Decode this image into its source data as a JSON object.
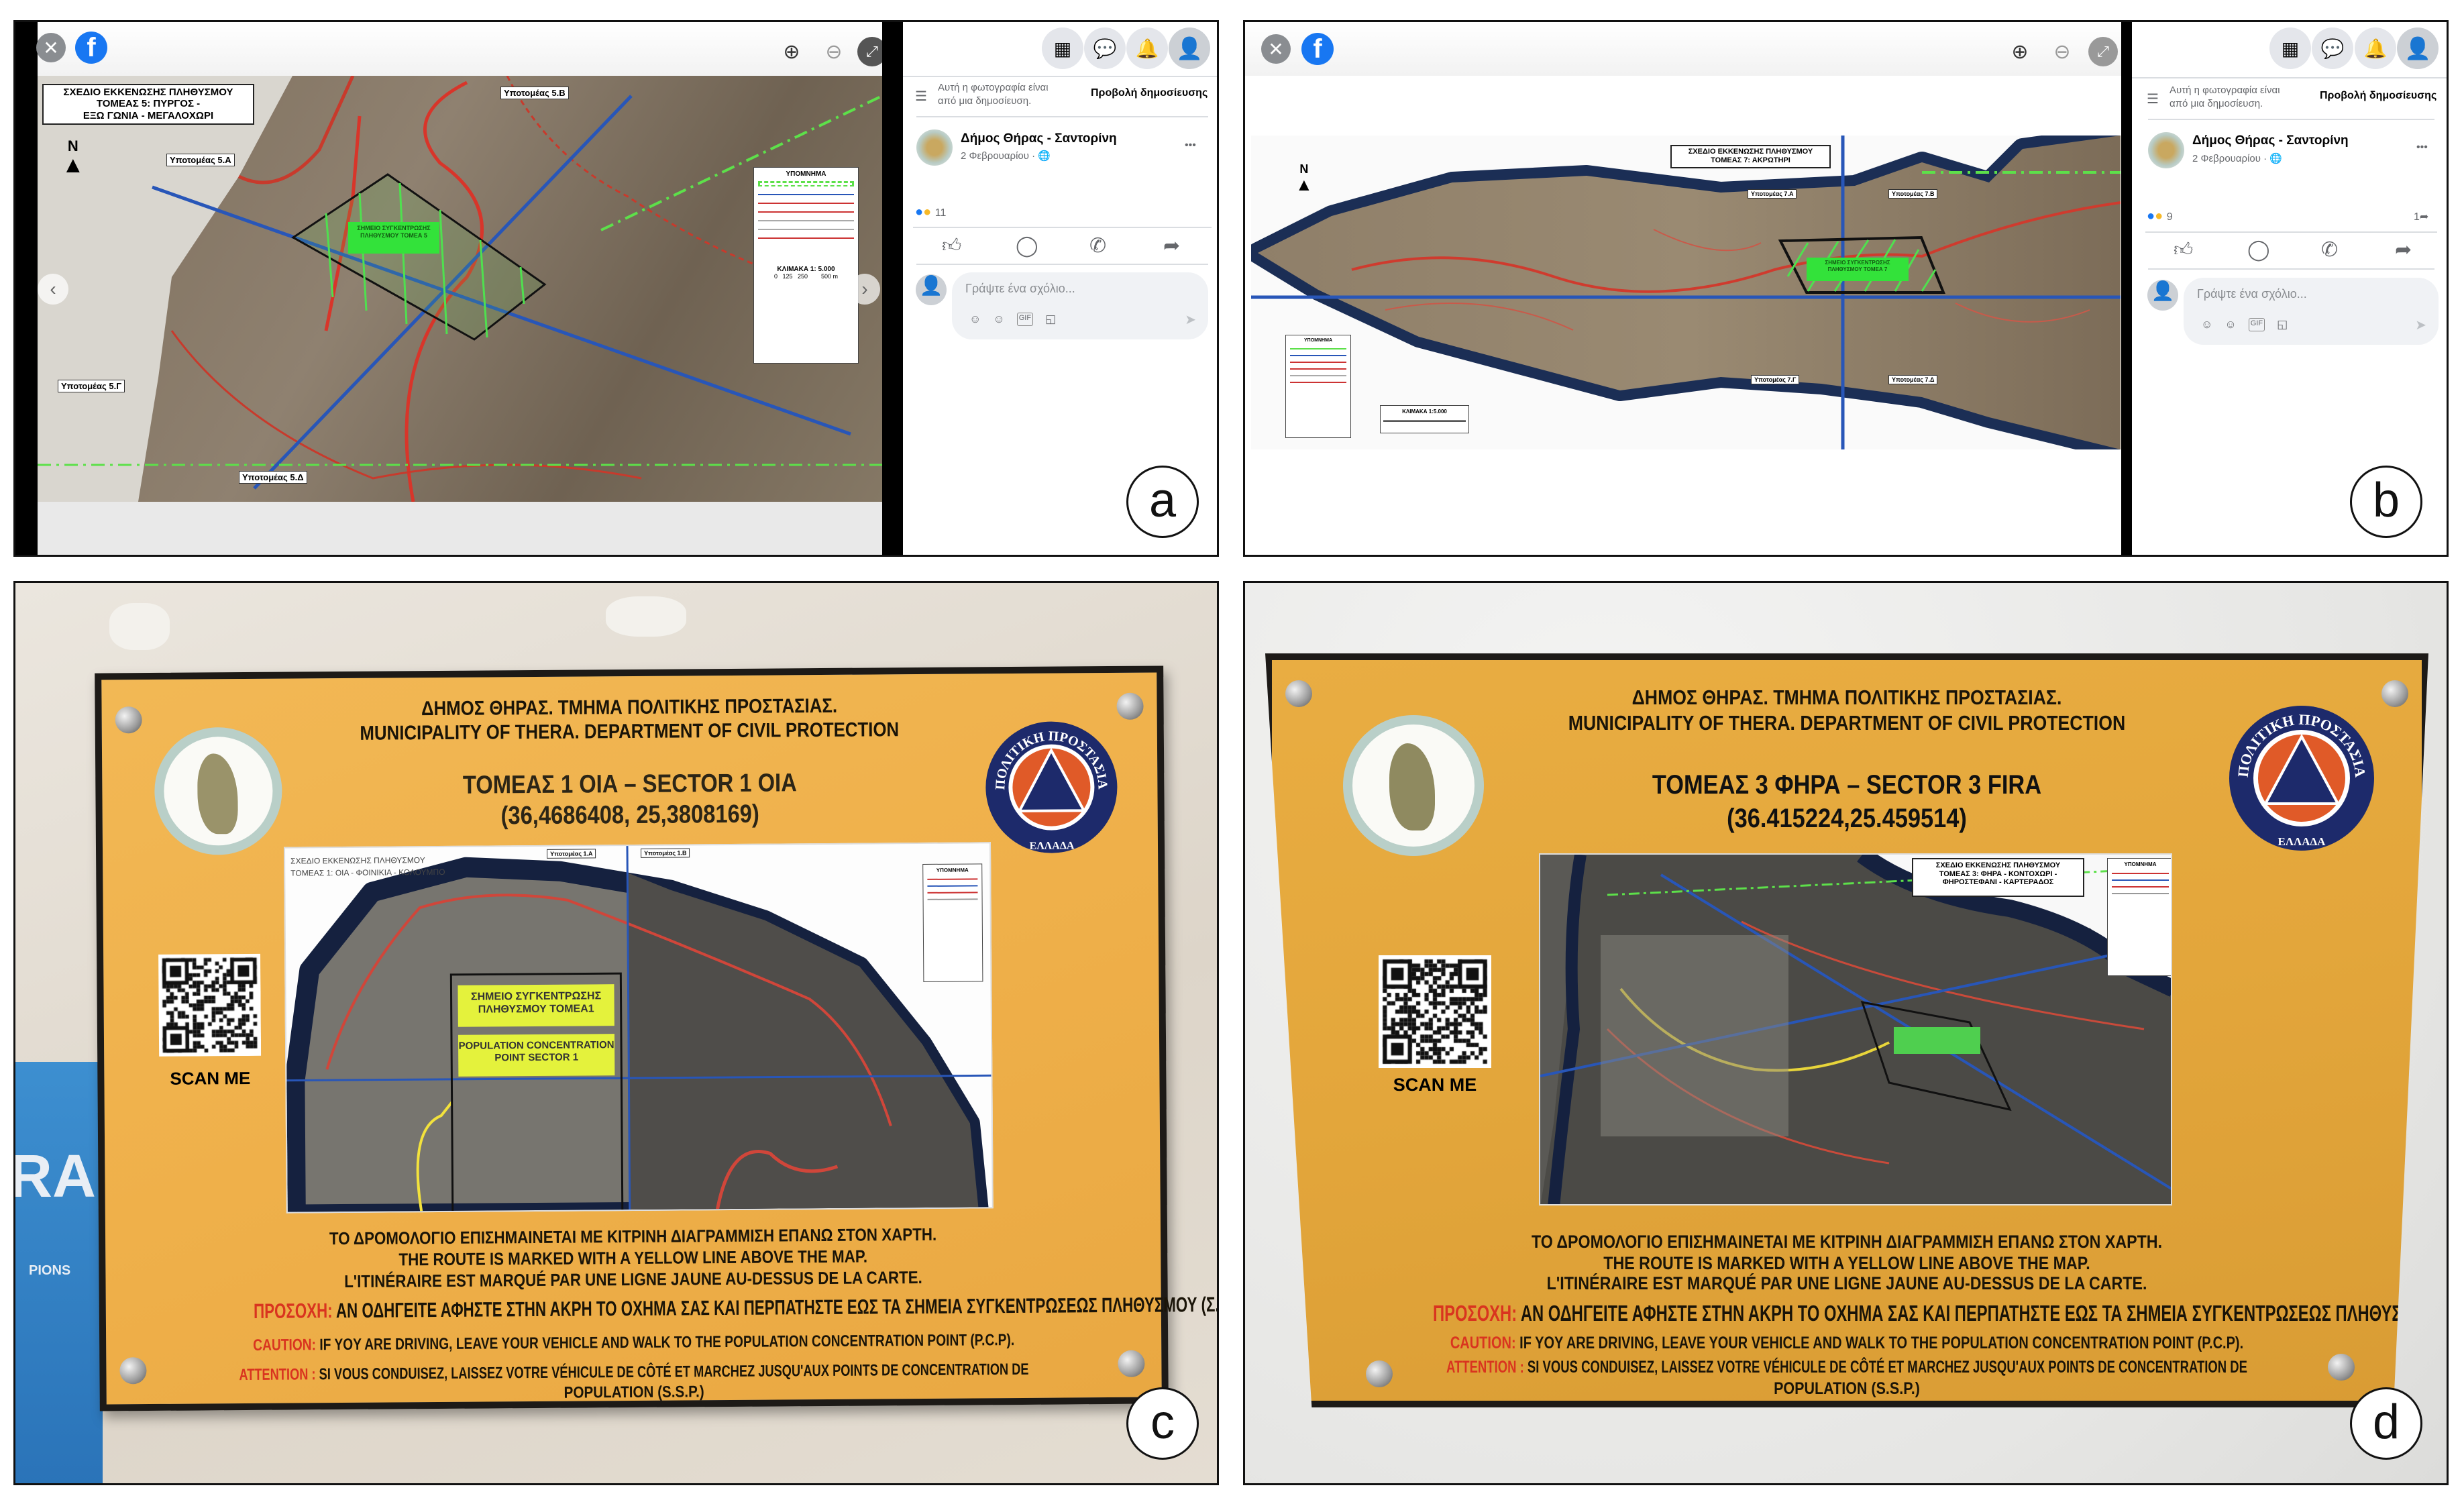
{
  "panel_labels": {
    "a": "a",
    "b": "b",
    "c": "c",
    "d": "d"
  },
  "facebook": {
    "info_text_line1": "Αυτή η φωτογραφία είναι",
    "info_text_line2": "από μια δημοσίευση.",
    "view_post": "Προβολή δημοσίευσης",
    "page_name": "Δήμος Θήρας - Σαντορίνη",
    "date": "2 Φεβρουαρίου ·",
    "comment_placeholder": "Γράψτε ένα σχόλιο...",
    "gif_label": "GIF",
    "more_label": "•••"
  },
  "panel_a": {
    "reaction_count": "11",
    "map": {
      "title_line1": "ΣΧΕΔΙΟ ΕΚΚΕΝΩΣΗΣ ΠΛΗΘΥΣΜΟΥ",
      "title_line2": "ΤΟΜΕΑΣ 5: ΠΥΡΓΟΣ -",
      "title_line3": "ΕΞΩ ΓΩΝΙΑ - ΜΕΓΑΛΟΧΩΡΙ",
      "north": "N",
      "subsectors": [
        "Υποτομέας 5.Α",
        "Υποτομέας 5.Β",
        "Υποτομέας 5.Γ",
        "Υποτομέας 5.Δ"
      ],
      "concentration_point": "ΣΗΜΕΙΟ ΣΥΓΚΕΝΤΡΩΣΗΣ ΠΛΗΘΥΣΜΟΥ ΤΟΜΕΑ 5",
      "legend_title": "ΥΠΟΜΝΗΜΑ",
      "scale": "ΚΛΙΜΑΚΑ 1: 5.000",
      "scale_ticks": "0   125   250        500 m"
    }
  },
  "panel_b": {
    "reaction_count": "9",
    "share_count": "1",
    "map": {
      "title_line1": "ΣΧΕΔΙΟ ΕΚΚΕΝΩΣΗΣ ΠΛΗΘΥΣΜΟΥ",
      "title_line2": "ΤΟΜΕΑΣ 7: ΑΚΡΩΤΗΡΙ",
      "north": "N",
      "subsectors": [
        "Υποτομέας 7.Α",
        "Υποτομέας 7.Β",
        "Υποτομέας 7.Γ",
        "Υποτομέας 7.Δ"
      ],
      "concentration_point": "ΣΗΜΕΙΟ ΣΥΓΚΕΝΤΡΩΣΗΣ ΠΛΗΘΥΣΜΟΥ ΤΟΜΕΑ 7",
      "legend_title": "ΥΠΟΜΝΗΜΑ",
      "scale": "ΚΛΙΜΑΚΑ 1:5.000"
    }
  },
  "sign_common": {
    "header_gr": "ΔΗΜΟΣ ΘΗΡΑΣ. ΤΜΗΜΑ ΠΟΛΙΤΙΚΗΣ ΠΡΟΣΤΑΣΙΑΣ.",
    "header_en": "MUNICIPALITY OF THERA. DEPARTMENT OF CIVIL PROTECTION",
    "scan_me": "SCAN ME",
    "route_gr": "ΤΟ ΔΡΟΜΟΛΟΓΙΟ ΕΠΙΣΗΜΑΙΝΕΤΑΙ ΜΕ ΚΙΤΡΙΝΗ ΔΙΑΓΡΑΜΜΙΣΗ ΕΠΑΝΩ ΣΤΟΝ ΧΑΡΤΗ.",
    "route_en": "THE ROUTE IS MARKED WITH A YELLOW LINE ABOVE THE MAP.",
    "route_fr": "L'ITINÉRAIRE EST MARQUÉ PAR UNE LIGNE JAUNE AU-DESSUS DE LA CARTE.",
    "warn_gr_label": "ΠΡΟΣΟΧΗ:",
    "warn_gr": "ΑΝ ΟΔΗΓΕΙΤΕ ΑΦΗΣΤΕ ΣΤΗΝ ΑΚΡΗ ΤΟ ΟΧΗΜΑ ΣΑΣ ΚΑΙ ΠΕΡΠΑΤΗΣΤΕ ΕΩΣ ΤΑ ΣΗΜΕΙΑ ΣΥΓΚΕΝΤΡΩΣΕΩΣ ΠΛΗΘΥΣΜΟΥ (Σ.Σ.Π).",
    "warn_en_label": "CAUTION:",
    "warn_en": "IF YOY ARE DRIVING, LEAVE YOUR VEHICLE AND WALK TO THE POPULATION CONCENTRATION POINT (P.C.P).",
    "warn_fr_label": "ATTENTION :",
    "warn_fr": "SI VOUS CONDUISEZ, LAISSEZ VOTRE VÉHICULE DE CÔTÉ ET MARCHEZ JUSQU'AUX POINTS DE CONCENTRATION DE",
    "warn_fr_line2": "POPULATION (S.S.P.)",
    "civil_protection_ring": "ΠΟΛΙΤΙΚΗ ΠΡΟΣΤΑΣΙΑ",
    "civil_protection_bottom": "ΕΛΛΑΔΑ",
    "legend_title": "ΥΠΟΜΝΗΜΑ"
  },
  "panel_c": {
    "title": "ΤΟΜΕΑΣ 1 ΟΙΑ – SECTOR 1 OIA",
    "coords": "(36,4686408, 25,3808169)",
    "map_title_line1": "ΣΧΕΔΙΟ ΕΚΚΕΝΩΣΗΣ ΠΛΗΘΥΣΜΟΥ",
    "map_title_line2": "ΤΟΜΕΑΣ 1: ΟΙΑ - ΦΟΙΝΙΚΙΑ - ΚΟΛΟΥΜΠΟ",
    "subsectors": [
      "Υποτομέας 1.Α",
      "Υποτομέας 1.Β"
    ],
    "point_gr_line1": "ΣΗΜΕΙΟ ΣΥΓΚΕΝΤΡΩΣΗΣ",
    "point_gr_line2": "ΠΛΗΘΥΣΜΟΥ ΤΟΜΕΑ1",
    "point_en_line1": "POPULATION CONCENTRATION",
    "point_en_line2": "POINT SECTOR 1",
    "poster_text": "RA",
    "poster_small": "PIONS"
  },
  "panel_d": {
    "title": "ΤΟΜΕΑΣ 3 ΦΗΡΑ – SECTOR 3 FIRA",
    "coords": "(36.415224,25.459514)",
    "map_title_line1": "ΣΧΕΔΙΟ ΕΚΚΕΝΩΣΗΣ ΠΛΗΘΥΣΜΟΥ",
    "map_title_line2": "ΤΟΜΕΑΣ 3: ΦΗΡΑ - ΚΟΝΤΟΧΩΡΙ -",
    "map_title_line3": "ΦΗΡΟΣΤΕΦΑΝΙ - ΚΑΡΤΕΡΑΔΟΣ"
  },
  "colors": {
    "facebook_blue": "#1877f2",
    "sign_c": "#efb24c",
    "sign_d": "#e3a63b",
    "civil_navy": "#1d2a6b",
    "civil_orange": "#e05a28"
  }
}
